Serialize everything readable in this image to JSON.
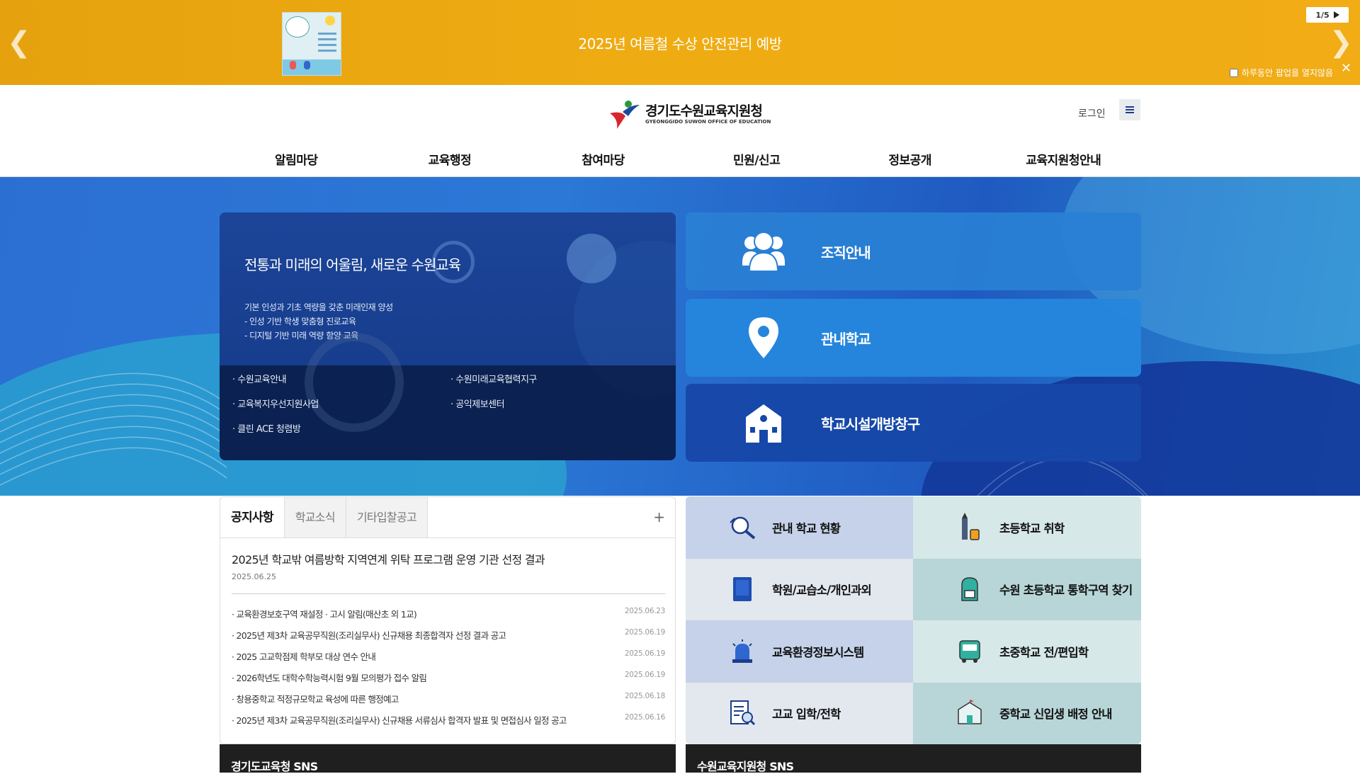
{
  "popup": {
    "title": "2025년 여름철 수상 안전관리 예방",
    "pager": "1/5",
    "dont_show": "하루동안 팝업을 열지않음",
    "prev": "❮",
    "next": "❯",
    "close": "✕"
  },
  "header": {
    "org_name_ko": "경기도수원교육지원청",
    "org_name_en": "GYEONGGIDO SUWON OFFICE OF EDUCATION",
    "login": "로그인"
  },
  "nav": [
    "알림마당",
    "교육행정",
    "참여마당",
    "민원/신고",
    "정보공개",
    "교육지원청안내"
  ],
  "hero": {
    "slogan": "전통과 미래의 어울림, 새로운 수원교육",
    "desc": [
      "기본 인성과 기초 역량을 갖춘 미래인재 양성",
      "- 인성 기반 학생 맞춤형 진로교육",
      "- 디지털 기반 미래 역량 함양 교육"
    ],
    "links": [
      "· 수원교육안내",
      "· 수원미래교육협력지구",
      "· 교육복지우선지원사업",
      "· 공익제보센터",
      "· 클린 ACE 청렴방"
    ],
    "quick": [
      {
        "label": "조직안내",
        "icon": "people-icon"
      },
      {
        "label": "관내학교",
        "icon": "location-pin-icon"
      },
      {
        "label": "학교시설개방창구",
        "icon": "school-building-icon"
      }
    ]
  },
  "board": {
    "tabs": [
      "공지사항",
      "학교소식",
      "기타입찰공고"
    ],
    "more": "+",
    "headline": "2025년 학교밖 여름방학 지역연계 위탁 프로그램 운영 기관 선정 결과",
    "headline_date": "2025.06.25",
    "rows": [
      {
        "title": "· 교육환경보호구역 재설정 · 고시 알림(매산초 외 1교)",
        "date": "2025.06.23"
      },
      {
        "title": "· 2025년 제3차 교육공무직원(조리실무사) 신규채용 최종합격자 선정 결과 공고",
        "date": "2025.06.19"
      },
      {
        "title": "· 2025 고교학점제 학부모 대상 연수 안내",
        "date": "2025.06.19"
      },
      {
        "title": "· 2026학년도 대학수학능력시험 9월 모의평가 접수 알림",
        "date": "2025.06.19"
      },
      {
        "title": "· 창용중학교 적정규모학교 육성에 따른 행정예고",
        "date": "2025.06.18"
      },
      {
        "title": "· 2025년 제3차 교육공무직원(조리실무사) 신규채용 서류심사 합격자 발표 및 면접심사 일정 공고",
        "date": "2025.06.16"
      }
    ]
  },
  "grid": [
    {
      "label": "관내 학교 현황",
      "icon": "search-school-icon",
      "bg": "#c5d2ea"
    },
    {
      "label": "초등학교 취학",
      "icon": "pencil-icon",
      "bg": "#d7e8e9"
    },
    {
      "label": "학원/교습소/개인과외",
      "icon": "book-icon",
      "bg": "#e3e7ee"
    },
    {
      "label": "수원 초등학교 통학구역 찾기",
      "icon": "backpack-icon",
      "bg": "#b8d6d8"
    },
    {
      "label": "교육환경정보시스템",
      "icon": "alarm-light-icon",
      "bg": "#c5d2ea"
    },
    {
      "label": "초중학교 전/편입학",
      "icon": "bus-icon",
      "bg": "#d7e8e9"
    },
    {
      "label": "고교 입학/전학",
      "icon": "document-search-icon",
      "bg": "#e3e7ee"
    },
    {
      "label": "중학교 신입생 배정 안내",
      "icon": "school-icon",
      "bg": "#b8d6d8"
    }
  ],
  "sns": [
    "경기도교육청 SNS",
    "수원교육지원청 SNS"
  ],
  "colors": {
    "popup_bg": "#efac12",
    "hero_blue": "#2b78d6",
    "navy": "#143a87"
  }
}
